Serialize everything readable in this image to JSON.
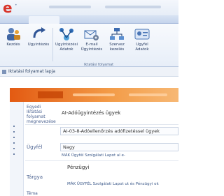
{
  "app": {
    "logo_glyph": "e",
    "logo_suffix": "•",
    "colors": {
      "logo": "#d8342a",
      "banner_start": "#e35a12",
      "banner_end": "#f7b874"
    }
  },
  "ribbon": {
    "tabs": [
      "",
      "",
      "",
      ""
    ],
    "buttons": [
      {
        "label": "Kezdés",
        "icon": "people-icon"
      },
      {
        "label": "Ügyintézés",
        "icon": "curved-arrow-icon"
      },
      {
        "label": "Ügyintézési\nAdatok",
        "icon": "network-icon"
      },
      {
        "label": "E-mail\nÜgyintézés",
        "icon": "mail-gear-icon"
      },
      {
        "label": "Szervez\nkezelés",
        "icon": "org-chart-icon"
      },
      {
        "label": "Ügyfél\nAdatok",
        "icon": "user-card-icon"
      }
    ],
    "group_label": "Iktatási folyamat"
  },
  "breadcrumb": {
    "text": "Iktatási folyamat lapja"
  },
  "form": {
    "header_label": "Egyedi\nIktatási\nfolyamat\nmegnevezése",
    "header_value": "AI-Adóügyintézés ügyek",
    "reference_value": "AI-03-8-Adóellenőrzés adófizetéssel ügyek",
    "ugyfel_label": "Ügyfél",
    "ugyfel_value": "Nagy",
    "ugyfel_sub": "MÁK Ügyfél Szolgálati Lapot al e-",
    "targy_label": "Tárgya",
    "targy_value": "Pénzügyi",
    "targy_sub": "MÁK ÜGYFÉL Szolgálati Lapot ut és Pénzügyi ok",
    "last_label": "Téma"
  }
}
